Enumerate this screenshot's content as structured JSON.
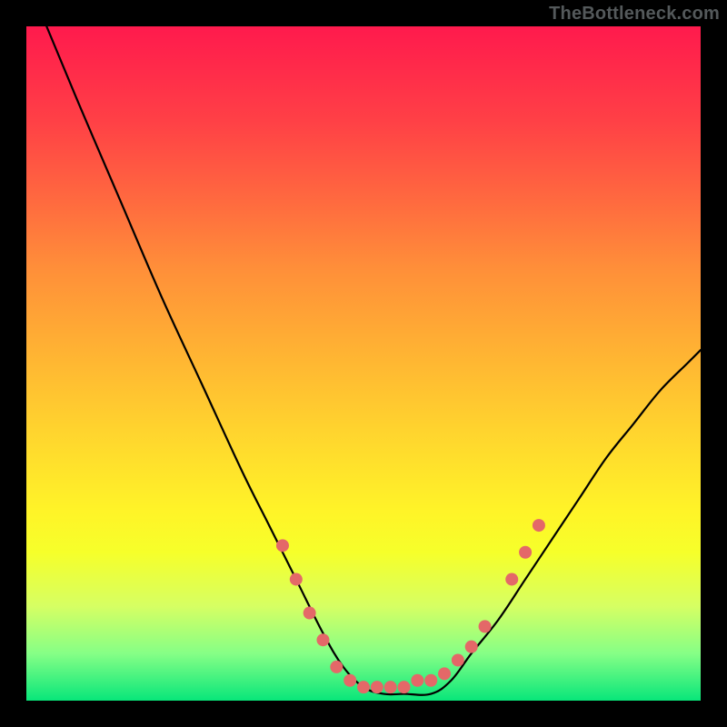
{
  "watermark": "TheBottleneck.com",
  "colors": {
    "gradient_top": "#ff1a4d",
    "gradient_bottom": "#08e67a",
    "curve": "#000000",
    "dots": "#e46868",
    "frame": "#000000"
  },
  "chart_data": {
    "type": "line",
    "title": "",
    "xlabel": "",
    "ylabel": "",
    "xlim": [
      0,
      100
    ],
    "ylim": [
      0,
      100
    ],
    "note": "x and y are relative percentages of the plot area; y=0 is bottom (green), y=100 is top (red).",
    "series": [
      {
        "name": "bottleneck-curve",
        "x": [
          3,
          8,
          14,
          20,
          26,
          32,
          36,
          40,
          44,
          47,
          50,
          53,
          56,
          60,
          63,
          66,
          70,
          74,
          78,
          82,
          86,
          90,
          94,
          98,
          100
        ],
        "y": [
          100,
          88,
          74,
          60,
          47,
          34,
          26,
          18,
          10,
          5,
          2,
          1,
          1,
          1,
          3,
          7,
          12,
          18,
          24,
          30,
          36,
          41,
          46,
          50,
          52
        ]
      }
    ],
    "highlight_dots": {
      "name": "trough-markers",
      "x": [
        38,
        40,
        42,
        44,
        46,
        48,
        50,
        52,
        54,
        56,
        58,
        60,
        62,
        64,
        66,
        68,
        72,
        74,
        76
      ],
      "y": [
        23,
        18,
        13,
        9,
        5,
        3,
        2,
        2,
        2,
        2,
        3,
        3,
        4,
        6,
        8,
        11,
        18,
        22,
        26
      ]
    }
  }
}
